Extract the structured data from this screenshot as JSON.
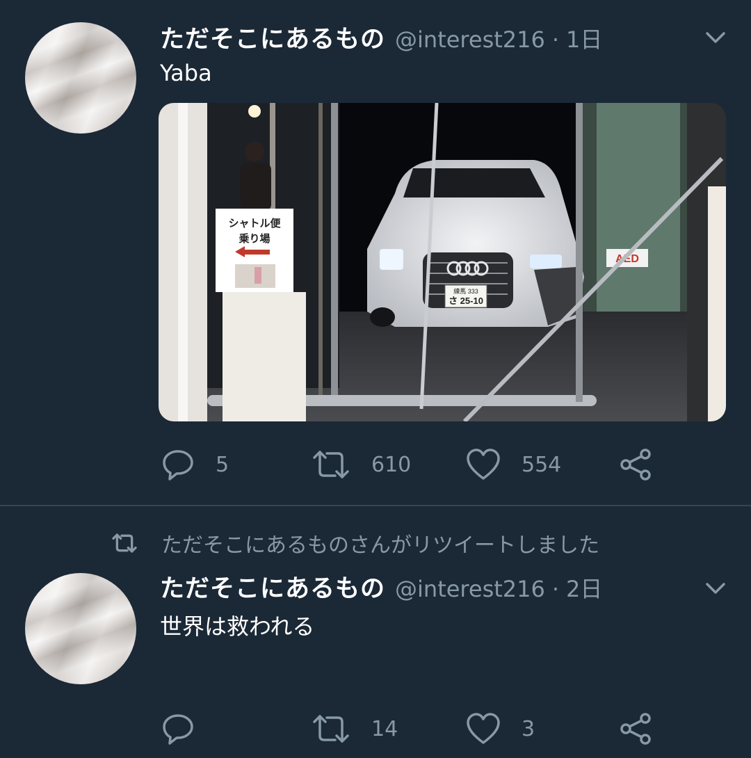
{
  "tweets": [
    {
      "name": "ただそこにあるもの",
      "handle": "@interest216",
      "dot": "·",
      "time": "1日",
      "text": "Yaba",
      "media": {
        "description_icon": "photo",
        "sign_line1": "シャトル便",
        "sign_line2": "乗り場",
        "plate_top": "練馬 333",
        "plate_bottom": "さ 25-10",
        "aed_label": "AED"
      },
      "replies": "5",
      "retweets": "610",
      "likes": "554"
    },
    {
      "retweet_context": "ただそこにあるものさんがリツイートしました",
      "name": "ただそこにあるもの",
      "handle": "@interest216",
      "dot": "·",
      "time": "2日",
      "text": "世界は救われる",
      "replies": "",
      "retweets": "14",
      "likes": "3"
    }
  ],
  "colors": {
    "background": "#1b2836",
    "secondary_text": "#8899a6",
    "divider": "#38444d"
  },
  "icons": [
    "reply-icon",
    "retweet-icon",
    "like-icon",
    "share-icon",
    "chevron-down-icon"
  ]
}
